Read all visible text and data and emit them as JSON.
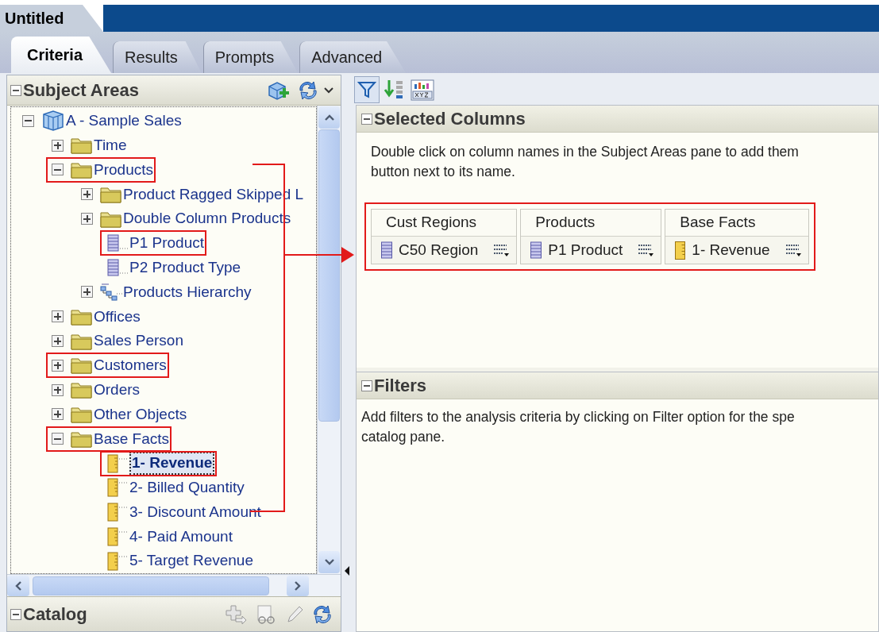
{
  "document_tab": {
    "title": "Untitled"
  },
  "tabs": [
    {
      "label": "Criteria",
      "selected": true
    },
    {
      "label": "Results",
      "selected": false
    },
    {
      "label": "Prompts",
      "selected": false
    },
    {
      "label": "Advanced",
      "selected": false
    }
  ],
  "subject_areas": {
    "title": "Subject Areas",
    "expanded": true,
    "tree": [
      {
        "label": "A - Sample Sales",
        "kind": "subject-area",
        "expanded": true,
        "selected": false,
        "annotated": false,
        "children": [
          {
            "label": "Time",
            "kind": "folder",
            "expanded": false,
            "selected": false,
            "annotated": false
          },
          {
            "label": "Products",
            "kind": "folder",
            "expanded": true,
            "selected": false,
            "annotated": true,
            "children": [
              {
                "label": "Product Ragged Skipped L",
                "kind": "folder",
                "expanded": false,
                "selected": false,
                "annotated": false
              },
              {
                "label": "Double Column Products",
                "kind": "folder",
                "expanded": false,
                "selected": false,
                "annotated": false
              },
              {
                "label": "P1 Product",
                "kind": "column",
                "selected": false,
                "annotated": true
              },
              {
                "label": "P2 Product Type",
                "kind": "column",
                "selected": false,
                "annotated": false
              },
              {
                "label": "Products Hierarchy",
                "kind": "hierarchy",
                "expanded": false,
                "selected": false,
                "annotated": false
              }
            ]
          },
          {
            "label": "Offices",
            "kind": "folder",
            "expanded": false,
            "selected": false,
            "annotated": false
          },
          {
            "label": "Sales Person",
            "kind": "folder",
            "expanded": false,
            "selected": false,
            "annotated": false
          },
          {
            "label": "Customers",
            "kind": "folder",
            "expanded": false,
            "selected": false,
            "annotated": true
          },
          {
            "label": "Orders",
            "kind": "folder",
            "expanded": false,
            "selected": false,
            "annotated": false
          },
          {
            "label": "Other Objects",
            "kind": "folder",
            "expanded": false,
            "selected": false,
            "annotated": false
          },
          {
            "label": "Base Facts",
            "kind": "folder",
            "expanded": true,
            "selected": false,
            "annotated": true,
            "children": [
              {
                "label": "1- Revenue",
                "kind": "measure",
                "selected": true,
                "annotated": true
              },
              {
                "label": "2- Billed Quantity",
                "kind": "measure",
                "selected": false,
                "annotated": false
              },
              {
                "label": "3- Discount Amount",
                "kind": "measure",
                "selected": false,
                "annotated": false
              },
              {
                "label": "4- Paid Amount",
                "kind": "measure",
                "selected": false,
                "annotated": false
              },
              {
                "label": "5- Target Revenue",
                "kind": "measure",
                "selected": false,
                "annotated": false
              }
            ]
          }
        ]
      }
    ]
  },
  "catalog": {
    "title": "Catalog",
    "expanded": true
  },
  "selected_columns": {
    "title": "Selected Columns",
    "expanded": true,
    "hint": "Double click on column names in the Subject Areas pane to add them",
    "hint_line_2": "button next to its name.",
    "annotated": true,
    "columns": [
      {
        "folder": "Cust Regions",
        "name": "C50 Region",
        "kind": "column"
      },
      {
        "folder": "Products",
        "name": "P1 Product",
        "kind": "column"
      },
      {
        "folder": "Base Facts",
        "name": "1- Revenue",
        "kind": "measure"
      }
    ]
  },
  "filters": {
    "title": "Filters",
    "expanded": true,
    "hint": "Add filters to the analysis criteria by clicking on Filter option for the spe",
    "hint_line_2": "catalog pane."
  }
}
